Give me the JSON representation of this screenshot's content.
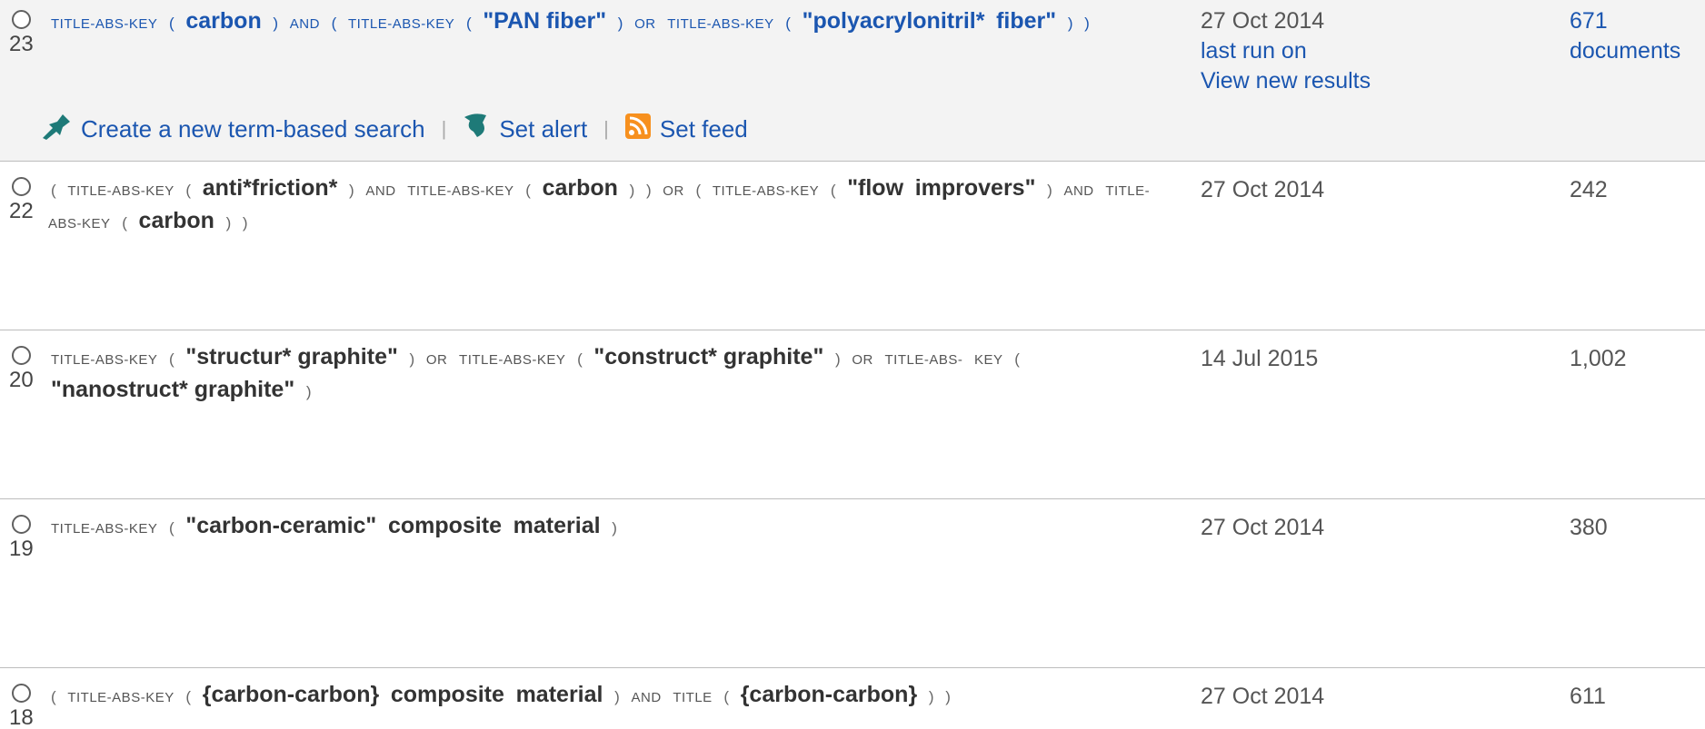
{
  "rows": [
    {
      "number": "23",
      "query_tokens": [
        {
          "k": "kw",
          "v": "TITLE-ABS-KEY"
        },
        {
          "k": "p",
          "v": "("
        },
        {
          "k": "t",
          "v": "carbon"
        },
        {
          "k": "p",
          "v": ")"
        },
        {
          "k": "kw",
          "v": "AND"
        },
        {
          "k": "p",
          "v": "("
        },
        {
          "k": "kw",
          "v": "TITLE-ABS-KEY"
        },
        {
          "k": "p",
          "v": "("
        },
        {
          "k": "t",
          "v": "\"PAN fiber\""
        },
        {
          "k": "p",
          "v": ")"
        },
        {
          "k": "kw",
          "v": "OR"
        },
        {
          "k": "kw",
          "v": "TITLE-ABS-KEY"
        },
        {
          "k": "p",
          "v": "("
        },
        {
          "k": "t",
          "v": "\"polyacrylonitril*"
        },
        {
          "k": "t",
          "v": "fiber\""
        },
        {
          "k": "p",
          "v": ")"
        },
        {
          "k": "p",
          "v": ")"
        }
      ],
      "date": "27 Oct 2014",
      "date_sub": "last run on",
      "date_link": "View new results",
      "docs": "671",
      "docs_sub": "documents"
    },
    {
      "number": "22",
      "query_tokens": [
        {
          "k": "p",
          "v": "("
        },
        {
          "k": "kw",
          "v": "TITLE-ABS-KEY"
        },
        {
          "k": "p",
          "v": "("
        },
        {
          "k": "t",
          "v": "anti*friction*"
        },
        {
          "k": "p",
          "v": ")"
        },
        {
          "k": "kw",
          "v": "AND"
        },
        {
          "k": "kw",
          "v": "TITLE-ABS-KEY"
        },
        {
          "k": "p",
          "v": "("
        },
        {
          "k": "t",
          "v": "carbon"
        },
        {
          "k": "p",
          "v": ")"
        },
        {
          "k": "p",
          "v": ")"
        },
        {
          "k": "kw",
          "v": "OR"
        },
        {
          "k": "p",
          "v": "("
        },
        {
          "k": "kw",
          "v": "TITLE-ABS-KEY"
        },
        {
          "k": "p",
          "v": "("
        },
        {
          "k": "t",
          "v": "\"flow"
        },
        {
          "k": "t",
          "v": "improvers\""
        },
        {
          "k": "p",
          "v": ")"
        },
        {
          "k": "kw",
          "v": "AND"
        },
        {
          "k": "kw",
          "v": "TITLE-ABS-KEY"
        },
        {
          "k": "p",
          "v": "("
        },
        {
          "k": "t",
          "v": "carbon"
        },
        {
          "k": "p",
          "v": ")"
        },
        {
          "k": "p",
          "v": ")"
        }
      ],
      "date": "27 Oct 2014",
      "docs": "242"
    },
    {
      "number": "20",
      "query_tokens": [
        {
          "k": "kw",
          "v": "TITLE-ABS-KEY"
        },
        {
          "k": "p",
          "v": "("
        },
        {
          "k": "t",
          "v": "\"structur* graphite\""
        },
        {
          "k": "p",
          "v": ")"
        },
        {
          "k": "kw",
          "v": "OR"
        },
        {
          "k": "kw",
          "v": "TITLE-ABS-KEY"
        },
        {
          "k": "p",
          "v": "("
        },
        {
          "k": "t",
          "v": "\"construct* graphite\""
        },
        {
          "k": "p",
          "v": ")"
        },
        {
          "k": "kw",
          "v": "OR"
        },
        {
          "k": "kw",
          "v": "TITLE-ABS-"
        },
        {
          "k": "kw",
          "v": "KEY"
        },
        {
          "k": "p",
          "v": "("
        },
        {
          "k": "t",
          "v": "\"nanostruct* graphite\""
        },
        {
          "k": "p",
          "v": ")"
        }
      ],
      "date": "14 Jul 2015",
      "docs": "1,002"
    },
    {
      "number": "19",
      "query_tokens": [
        {
          "k": "kw",
          "v": "TITLE-ABS-KEY"
        },
        {
          "k": "p",
          "v": "("
        },
        {
          "k": "t",
          "v": "\"carbon-ceramic\""
        },
        {
          "k": "t",
          "v": "composite"
        },
        {
          "k": "t",
          "v": "material"
        },
        {
          "k": "p",
          "v": ")"
        }
      ],
      "date": "27 Oct 2014",
      "docs": "380"
    },
    {
      "number": "18",
      "query_tokens": [
        {
          "k": "p",
          "v": "("
        },
        {
          "k": "kw",
          "v": "TITLE-ABS-KEY"
        },
        {
          "k": "p",
          "v": "("
        },
        {
          "k": "t",
          "v": "{carbon-carbon}"
        },
        {
          "k": "t",
          "v": "composite"
        },
        {
          "k": "t",
          "v": "material"
        },
        {
          "k": "p",
          "v": ")"
        },
        {
          "k": "kw",
          "v": "AND"
        },
        {
          "k": "kw",
          "v": "TITLE"
        },
        {
          "k": "p",
          "v": "("
        },
        {
          "k": "t",
          "v": "{carbon-carbon}"
        },
        {
          "k": "p",
          "v": ")"
        },
        {
          "k": "p",
          "v": ")"
        }
      ],
      "date": "27 Oct 2014",
      "docs": "611"
    }
  ],
  "actions": {
    "term_search": "Create a new term-based search",
    "set_alert": "Set alert",
    "set_feed": "Set feed",
    "separator": "|"
  },
  "icons": {
    "term_search": "pin-icon",
    "set_alert": "bell-icon",
    "set_feed": "rss-icon"
  },
  "colors": {
    "link": "#1b56b0",
    "rss": "#f7901e",
    "text": "#555555",
    "highlight_bg": "#f3f3f3"
  }
}
